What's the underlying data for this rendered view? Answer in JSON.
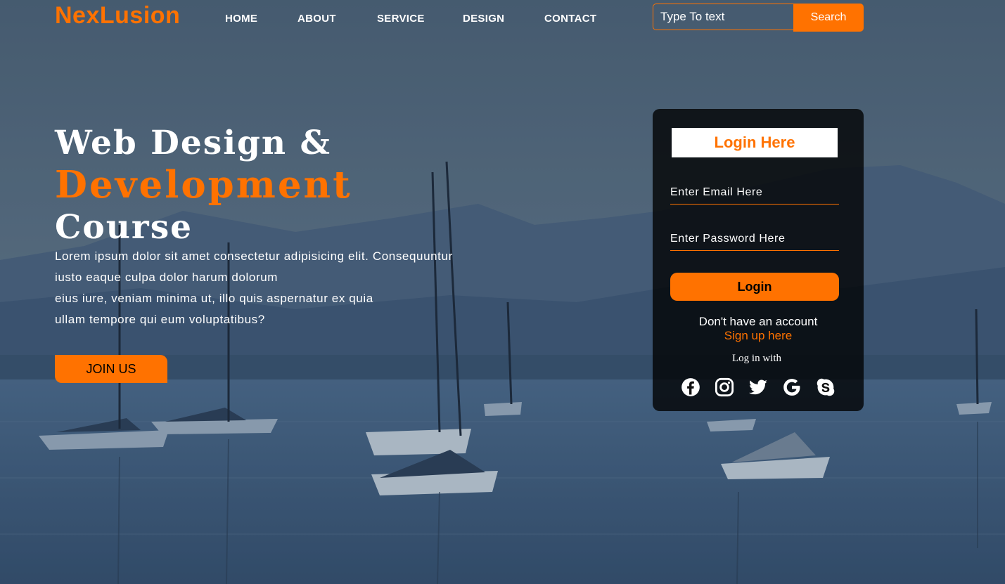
{
  "brand": {
    "logo": "NexLusion",
    "accent_color": "#ff7200"
  },
  "nav": {
    "items": [
      {
        "label": "HOME"
      },
      {
        "label": "ABOUT"
      },
      {
        "label": "SERVICE"
      },
      {
        "label": "DESIGN"
      },
      {
        "label": "CONTACT"
      }
    ]
  },
  "search": {
    "placeholder": "Type To text",
    "button_label": "Search"
  },
  "hero": {
    "line1": "Web Design &",
    "line2": "Development",
    "line3": "Course",
    "text_lines": [
      "Lorem ipsum dolor sit amet consectetur adipisicing elit. Consequuntur",
      "iusto eaque culpa dolor harum dolorum",
      "eius iure, veniam minima ut, illo quis aspernatur ex quia",
      "ullam tempore qui eum voluptatibus?"
    ],
    "cta_label": "JOIN US"
  },
  "login": {
    "title": "Login Here",
    "email_placeholder": "Enter Email Here",
    "password_placeholder": "Enter Password Here",
    "button_label": "Login",
    "no_account_text": "Don't have an account",
    "signup_link": "Sign up here",
    "login_with": "Log in with",
    "social_icons": [
      "facebook-icon",
      "instagram-icon",
      "twitter-icon",
      "google-icon",
      "skype-icon"
    ]
  }
}
